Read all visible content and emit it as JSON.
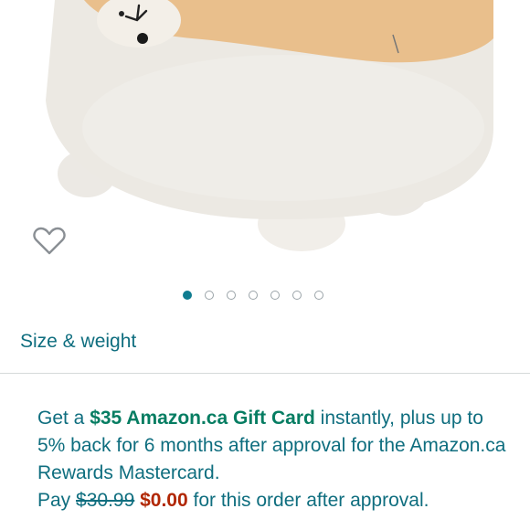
{
  "product": {
    "image_alt": "plush toy",
    "carousel": {
      "total": 7,
      "active": 0
    }
  },
  "size_weight_label": "Size & weight",
  "promo": {
    "line1_pre": "Get a ",
    "line1_strong": "$35 Amazon.ca Gift Card",
    "line1_post": " instantly, plus up to 5% back for 6 months after approval for the Amazon.ca Rewards Mastercard.",
    "pay_pre": "Pay ",
    "old_price": "$30.99",
    "new_price": "$0.00",
    "pay_post": " for this order after approval."
  },
  "colors": {
    "accent": "#0f7c90",
    "link": "#0f6e7f",
    "green": "#067d62",
    "price_red": "#b12704"
  }
}
